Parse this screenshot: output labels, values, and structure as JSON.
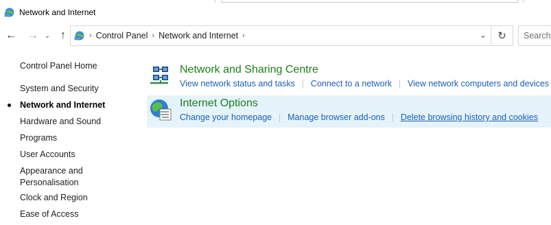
{
  "window": {
    "title": "Network and Internet"
  },
  "address": {
    "crumbs": [
      "Control Panel",
      "Network and Internet"
    ],
    "search_placeholder": "Search C"
  },
  "sidebar": {
    "items": [
      {
        "label": "Control Panel Home",
        "active": false
      },
      {
        "label": "System and Security",
        "active": false
      },
      {
        "label": "Network and Internet",
        "active": true
      },
      {
        "label": "Hardware and Sound",
        "active": false
      },
      {
        "label": "Programs",
        "active": false
      },
      {
        "label": "User Accounts",
        "active": false
      },
      {
        "label": "Appearance and",
        "active": false
      },
      {
        "label": "Personalisation",
        "active": false
      },
      {
        "label": "Clock and Region",
        "active": false
      },
      {
        "label": "Ease of Access",
        "active": false
      }
    ]
  },
  "categories": [
    {
      "title": "Network and Sharing Centre",
      "icon": "network-sharing-icon",
      "links": [
        "View network status and tasks",
        "Connect to a network",
        "View network computers and devices"
      ]
    },
    {
      "title": "Internet Options",
      "icon": "internet-options-icon",
      "links": [
        "Change your homepage",
        "Manage browser add-ons",
        "Delete browsing history and cookies"
      ]
    }
  ],
  "colors": {
    "link": "#1a5fb4",
    "category_title": "#1b7e1b",
    "highlight": "#e5f3fb"
  }
}
